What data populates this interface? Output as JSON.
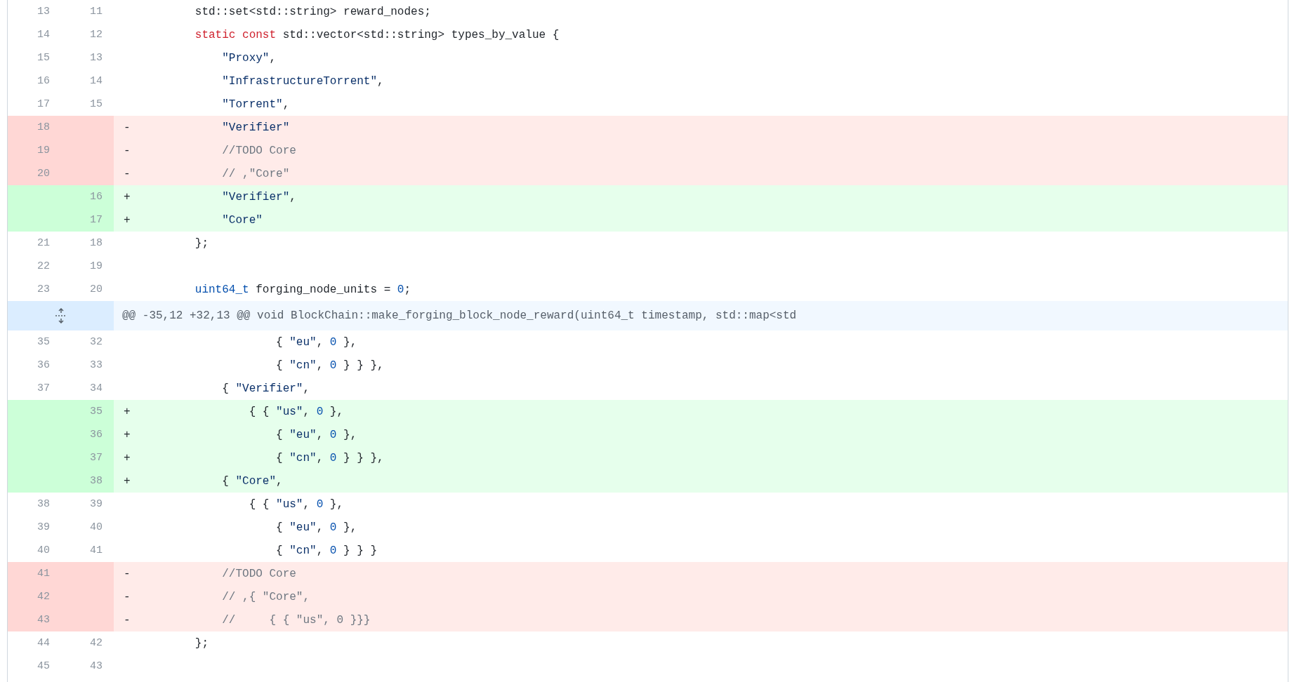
{
  "diff": {
    "rows": [
      {
        "kind": "context",
        "old": "13",
        "new": "11",
        "code": [
          {
            "text": "        std::set<std::string> reward_nodes;",
            "kind": "plain"
          }
        ]
      },
      {
        "kind": "context",
        "old": "14",
        "new": "12",
        "code": [
          {
            "text": "        static",
            "kind": "keyword"
          },
          {
            "text": " const",
            "kind": "keyword"
          },
          {
            "text": " std::vector<std::string> types_by_value {",
            "kind": "plain"
          }
        ]
      },
      {
        "kind": "context",
        "old": "15",
        "new": "13",
        "code": [
          {
            "text": "            \"Proxy\"",
            "kind": "string"
          },
          {
            "text": ",",
            "kind": "plain"
          }
        ]
      },
      {
        "kind": "context",
        "old": "16",
        "new": "14",
        "code": [
          {
            "text": "            \"InfrastructureTorrent\"",
            "kind": "string"
          },
          {
            "text": ",",
            "kind": "plain"
          }
        ]
      },
      {
        "kind": "context",
        "old": "17",
        "new": "15",
        "code": [
          {
            "text": "            \"Torrent\"",
            "kind": "string"
          },
          {
            "text": ",",
            "kind": "plain"
          }
        ]
      },
      {
        "kind": "deleted",
        "old": "18",
        "marker": "-",
        "code": [
          {
            "text": "            \"Verifier\"",
            "kind": "string"
          }
        ]
      },
      {
        "kind": "deleted",
        "old": "19",
        "marker": "-",
        "code": [
          {
            "text": "            //TODO Core",
            "kind": "comment"
          }
        ]
      },
      {
        "kind": "deleted",
        "old": "20",
        "marker": "-",
        "code": [
          {
            "text": "            // ,\"Core\"",
            "kind": "comment"
          }
        ]
      },
      {
        "kind": "added",
        "new": "16",
        "marker": "+",
        "code": [
          {
            "text": "            \"Verifier\"",
            "kind": "string"
          },
          {
            "text": ",",
            "kind": "plain"
          }
        ]
      },
      {
        "kind": "added",
        "new": "17",
        "marker": "+",
        "code": [
          {
            "text": "            \"Core\"",
            "kind": "string"
          }
        ]
      },
      {
        "kind": "context",
        "old": "21",
        "new": "18",
        "code": [
          {
            "text": "        };",
            "kind": "plain"
          }
        ]
      },
      {
        "kind": "context",
        "old": "22",
        "new": "19"
      },
      {
        "kind": "context",
        "old": "23",
        "new": "20",
        "code": [
          {
            "text": "        uint64_t",
            "kind": "type"
          },
          {
            "text": " forging_node_units = ",
            "kind": "plain"
          },
          {
            "text": "0",
            "kind": "number"
          },
          {
            "text": ";",
            "kind": "plain"
          }
        ]
      },
      {
        "kind": "hunk",
        "header": "@@ -35,12 +32,13 @@ void BlockChain::make_forging_block_node_reward(uint64_t timestamp, std::map<std"
      },
      {
        "kind": "context",
        "old": "35",
        "new": "32",
        "code": [
          {
            "text": "                    { ",
            "kind": "plain"
          },
          {
            "text": "\"eu\"",
            "kind": "string"
          },
          {
            "text": ", ",
            "kind": "plain"
          },
          {
            "text": "0",
            "kind": "number"
          },
          {
            "text": " },",
            "kind": "plain"
          }
        ]
      },
      {
        "kind": "context",
        "old": "36",
        "new": "33",
        "code": [
          {
            "text": "                    { ",
            "kind": "plain"
          },
          {
            "text": "\"cn\"",
            "kind": "string"
          },
          {
            "text": ", ",
            "kind": "plain"
          },
          {
            "text": "0",
            "kind": "number"
          },
          {
            "text": " } } },",
            "kind": "plain"
          }
        ]
      },
      {
        "kind": "context",
        "old": "37",
        "new": "34",
        "code": [
          {
            "text": "            { ",
            "kind": "plain"
          },
          {
            "text": "\"Verifier\"",
            "kind": "string"
          },
          {
            "text": ",",
            "kind": "plain"
          }
        ]
      },
      {
        "kind": "added",
        "new": "35",
        "marker": "+",
        "code": [
          {
            "text": "                { { ",
            "kind": "plain"
          },
          {
            "text": "\"us\"",
            "kind": "string"
          },
          {
            "text": ", ",
            "kind": "plain"
          },
          {
            "text": "0",
            "kind": "number"
          },
          {
            "text": " },",
            "kind": "plain"
          }
        ]
      },
      {
        "kind": "added",
        "new": "36",
        "marker": "+",
        "code": [
          {
            "text": "                    { ",
            "kind": "plain"
          },
          {
            "text": "\"eu\"",
            "kind": "string"
          },
          {
            "text": ", ",
            "kind": "plain"
          },
          {
            "text": "0",
            "kind": "number"
          },
          {
            "text": " },",
            "kind": "plain"
          }
        ]
      },
      {
        "kind": "added",
        "new": "37",
        "marker": "+",
        "code": [
          {
            "text": "                    { ",
            "kind": "plain"
          },
          {
            "text": "\"cn\"",
            "kind": "string"
          },
          {
            "text": ", ",
            "kind": "plain"
          },
          {
            "text": "0",
            "kind": "number"
          },
          {
            "text": " } } },",
            "kind": "plain"
          }
        ]
      },
      {
        "kind": "added",
        "new": "38",
        "marker": "+",
        "code": [
          {
            "text": "            { ",
            "kind": "plain"
          },
          {
            "text": "\"Core\"",
            "kind": "string"
          },
          {
            "text": ",",
            "kind": "plain"
          }
        ]
      },
      {
        "kind": "context",
        "old": "38",
        "new": "39",
        "code": [
          {
            "text": "                { { ",
            "kind": "plain"
          },
          {
            "text": "\"us\"",
            "kind": "string"
          },
          {
            "text": ", ",
            "kind": "plain"
          },
          {
            "text": "0",
            "kind": "number"
          },
          {
            "text": " },",
            "kind": "plain"
          }
        ]
      },
      {
        "kind": "context",
        "old": "39",
        "new": "40",
        "code": [
          {
            "text": "                    { ",
            "kind": "plain"
          },
          {
            "text": "\"eu\"",
            "kind": "string"
          },
          {
            "text": ", ",
            "kind": "plain"
          },
          {
            "text": "0",
            "kind": "number"
          },
          {
            "text": " },",
            "kind": "plain"
          }
        ]
      },
      {
        "kind": "context",
        "old": "40",
        "new": "41",
        "code": [
          {
            "text": "                    { ",
            "kind": "plain"
          },
          {
            "text": "\"cn\"",
            "kind": "string"
          },
          {
            "text": ", ",
            "kind": "plain"
          },
          {
            "text": "0",
            "kind": "number"
          },
          {
            "text": " } } }",
            "kind": "plain"
          }
        ]
      },
      {
        "kind": "deleted",
        "old": "41",
        "marker": "-",
        "code": [
          {
            "text": "            //TODO Core",
            "kind": "comment"
          }
        ]
      },
      {
        "kind": "deleted",
        "old": "42",
        "marker": "-",
        "code": [
          {
            "text": "            // ,{ \"Core\",",
            "kind": "comment"
          }
        ]
      },
      {
        "kind": "deleted",
        "old": "43",
        "marker": "-",
        "code": [
          {
            "text": "            //     { { \"us\", 0 }}}",
            "kind": "comment"
          }
        ]
      },
      {
        "kind": "context",
        "old": "44",
        "new": "42",
        "code": [
          {
            "text": "        };",
            "kind": "plain"
          }
        ]
      },
      {
        "kind": "context",
        "old": "45",
        "new": "43"
      }
    ]
  }
}
